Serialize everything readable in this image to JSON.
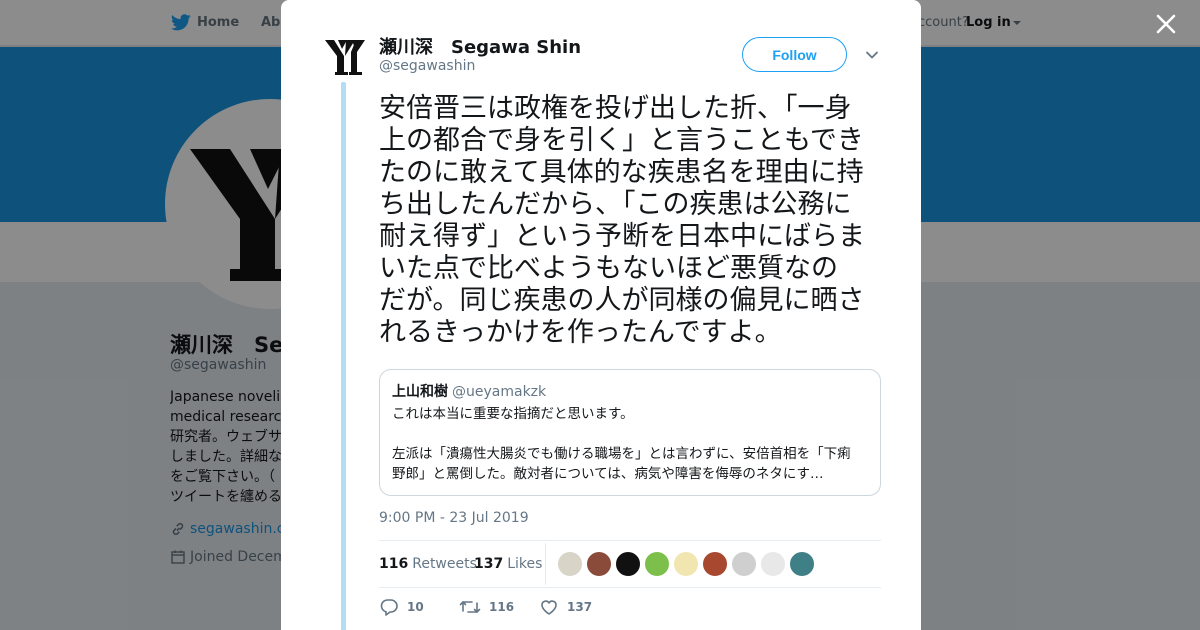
{
  "nav": {
    "home_label": "Home",
    "about_label": "Abo",
    "account_prompt": "ccount?",
    "login_label": "Log in"
  },
  "profile": {
    "name": "瀬川深　Se",
    "handle": "@segawashin",
    "bio": "Japanese novelist\nmedical researche\n研究者。ウェブサ\nしました。詳細な\nをご覧下さい。（\nツイートを纏める",
    "link": "segawashin.co",
    "joined": "Joined Decem"
  },
  "tweet": {
    "author_name": "瀬川深　Segawa Shin",
    "author_handle": "@segawashin",
    "follow_label": "Follow",
    "text": "安倍晋三は政権を投げ出した折、「一身\n上の都合で身を引く」と言うこともでき\nたのに敢えて具体的な疾患名を理由に持\nち出したんだから、「この疾患は公務に\n耐え得ず」という予断を日本中にばらま\nいた点で比べようもないほど悪質なの\nだが。同じ疾患の人が同様の偏見に晒さ\nれるきっかけを作ったんですよ。",
    "quote": {
      "name": "上山和樹",
      "handle": "@ueyamakzk",
      "text": "これは本当に重要な指摘だと思います。\n\n左派は「潰瘍性大腸炎でも働ける職場を」とは言わずに、安倍首相を「下痢\n野郎」と罵倒した。敵対者については、病気や障害を侮辱のネタにす…"
    },
    "timestamp": "9:00 PM - 23 Jul 2019",
    "retweets_count": "116",
    "retweets_label": "Retweets",
    "likes_count": "137",
    "likes_label": "Likes",
    "reply_count": "10",
    "retweet_action_count": "116",
    "like_action_count": "137"
  },
  "likers": [
    "#d9d4c8",
    "#8a4b3a",
    "#111111",
    "#7cc04b",
    "#f2e6b0",
    "#a8492f",
    "#cfcfcf",
    "#e8e8e8",
    "#3f7f86"
  ],
  "icons": [
    "twitter-bird-icon",
    "close-icon",
    "chevron-down-icon",
    "link-icon",
    "calendar-icon",
    "reply-icon",
    "retweet-icon",
    "heart-icon"
  ],
  "colors": {
    "accent": "#1da1f2",
    "banner": "#1b95e0",
    "thread_line": "#b3ddf5",
    "muted_text": "#657786"
  }
}
